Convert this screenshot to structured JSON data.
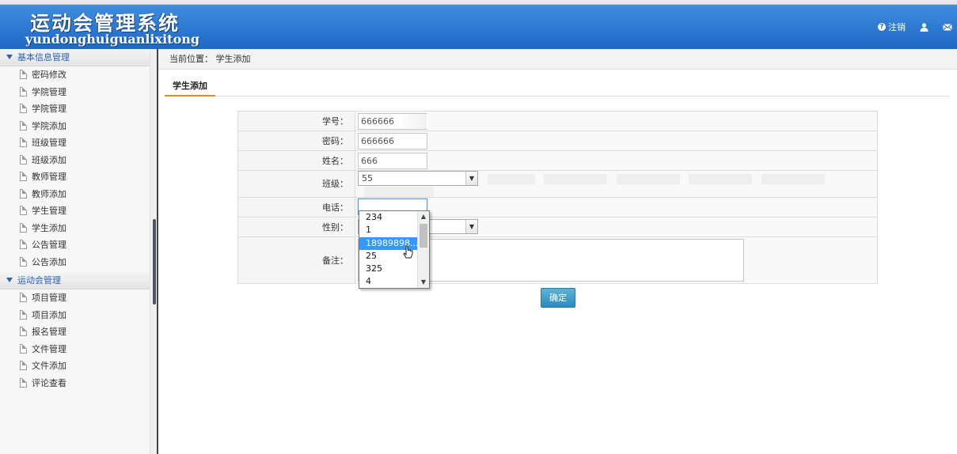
{
  "header": {
    "title_cn": "运动会管理系统",
    "title_pinyin": "yundonghuiguanlixitong",
    "logout_label": "注销",
    "icons": [
      "help-icon",
      "user-icon",
      "mail-icon"
    ]
  },
  "sidebar": {
    "sections": [
      {
        "title": "基本信息管理",
        "items": [
          "密码修改",
          "学院管理",
          "学院管理",
          "学院添加",
          "班级管理",
          "班级添加",
          "教师管理",
          "教师添加",
          "学生管理",
          "学生添加",
          "公告管理",
          "公告添加"
        ]
      },
      {
        "title": "运动会管理",
        "items": [
          "项目管理",
          "项目添加",
          "报名管理",
          "文件管理",
          "文件添加",
          "评论查看"
        ]
      }
    ]
  },
  "main": {
    "breadcrumb": "当前位置： 学生添加",
    "tab": "学生添加",
    "form": {
      "student_id_label": "学号：",
      "student_id_value": "666666",
      "password_label": "密码：",
      "password_value": "666666",
      "name_label": "姓名：",
      "name_value": "666",
      "class_label": "班级：",
      "class_value": "55",
      "phone_label": "电话：",
      "phone_value": "",
      "gender_label": "性别：",
      "gender_value": "",
      "remark_label": "备注：",
      "remark_value": ""
    },
    "confirm_label": "确定"
  },
  "autocomplete": {
    "options": [
      "234",
      "1",
      "18989898...",
      "25",
      "325",
      "4"
    ],
    "selected_index": 2
  },
  "colors": {
    "header_top": "#3f8ee0",
    "header_bottom": "#1f67c4",
    "selection": "#3399ff",
    "confirm_button": "#2a8bbb",
    "tab_underline": "#e08a2c"
  }
}
